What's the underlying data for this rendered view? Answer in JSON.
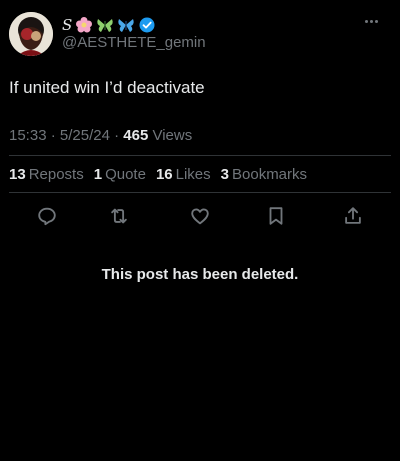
{
  "header": {
    "display_name": "S",
    "emojis": [
      "flower-emoji",
      "butterfly-emoji",
      "blue-butterfly-emoji"
    ],
    "verified": true,
    "handle": "@AESTHETE_gemin"
  },
  "tweet": {
    "text": "If united win I’d deactivate",
    "time": "15:33",
    "date": "5/25/24",
    "views_count": "465",
    "views_label": "Views"
  },
  "stats": [
    {
      "count": "13",
      "label": "Reposts"
    },
    {
      "count": "1",
      "label": "Quote"
    },
    {
      "count": "16",
      "label": "Likes"
    },
    {
      "count": "3",
      "label": "Bookmarks"
    }
  ],
  "actions": [
    "reply-icon",
    "repost-icon",
    "like-icon",
    "bookmark-icon",
    "share-icon"
  ],
  "notice": "This post has been deleted.",
  "colors": {
    "background": "#000000",
    "text": "#e7e9ea",
    "muted": "#71767b",
    "verified": "#1d9bf0",
    "divider": "#2f3336"
  }
}
